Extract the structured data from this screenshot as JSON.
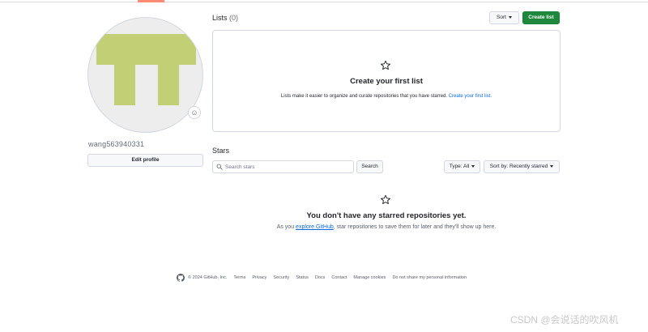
{
  "profile": {
    "username": "wang563940331",
    "edit_profile_label": "Edit profile",
    "avatar_color": "#c2cf74",
    "emoji_icon": "smiley-icon"
  },
  "lists": {
    "title": "Lists",
    "count": "(0)",
    "sort_label": "Sort",
    "create_label": "Create list",
    "empty_title": "Create your first list",
    "empty_desc": "Lists make it easier to organize and curate repositories that you have starred.",
    "empty_link": "Create your first list."
  },
  "stars": {
    "title": "Stars",
    "search_placeholder": "Search stars",
    "search_button": "Search",
    "type_filter": "Type: All",
    "sort_filter": "Sort by: Recently starred",
    "empty_title": "You don't have any starred repositories yet.",
    "empty_desc_prefix": "As you",
    "empty_desc_link": "explore GitHub",
    "empty_desc_suffix": ", star repositories to save them for later and they'll show up here."
  },
  "footer": {
    "copyright": "© 2024 GitHub, Inc.",
    "links": [
      "Terms",
      "Privacy",
      "Security",
      "Status",
      "Docs",
      "Contact",
      "Manage cookies",
      "Do not share my personal information"
    ]
  },
  "watermark": "CSDN @会说话的吹风机",
  "colors": {
    "primary_green": "#1f883d",
    "link_blue": "#0969da",
    "tab_underline": "#fd8c73"
  }
}
